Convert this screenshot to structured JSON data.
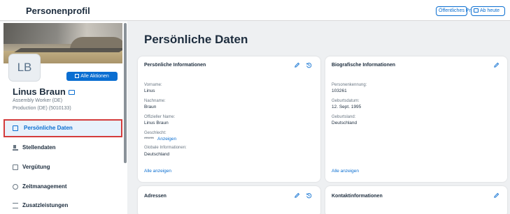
{
  "header": {
    "title": "Personenprofil",
    "public_profile_label": "Öffentliches Profil",
    "as_of_label": "Ab heute"
  },
  "profile": {
    "avatar_initials": "LB",
    "actions_label": "Alle Aktionen",
    "name": "Linus Braun",
    "job_title": "Assembly Worker (DE)",
    "org": "Production (DE) (5010133)"
  },
  "nav": {
    "items": [
      {
        "label": "Persönliche Daten",
        "icon": "person-card-icon",
        "active": true
      },
      {
        "label": "Stellendaten",
        "icon": "job-icon",
        "active": false
      },
      {
        "label": "Vergütung",
        "icon": "money-icon",
        "active": false
      },
      {
        "label": "Zeitmanagement",
        "icon": "clock-icon",
        "active": false
      },
      {
        "label": "Zusatzleistungen",
        "icon": "benefits-icon",
        "active": false
      }
    ]
  },
  "main": {
    "page_title": "Persönliche Daten",
    "personal_info": {
      "title": "Persönliche Informationen",
      "first_name_label": "Vorname:",
      "first_name": "Linus",
      "last_name_label": "Nachname:",
      "last_name": "Braun",
      "official_name_label": "Offizieller Name:",
      "official_name": "Linus Braun",
      "gender_label": "Geschlecht:",
      "gender_masked": "******",
      "show_label": "Anzeigen",
      "global_info_label": "Globale Informationen:",
      "global_info": "Deutschland",
      "show_all": "Alle anzeigen"
    },
    "bio_info": {
      "title": "Biografische Informationen",
      "person_id_label": "Personenkennung:",
      "person_id": "103261",
      "birth_date_label": "Geburtsdatum:",
      "birth_date": "12. Sept. 1995",
      "birth_country_label": "Geburtsland:",
      "birth_country": "Deutschland",
      "show_all": "Alle anzeigen"
    },
    "addresses": {
      "title": "Adressen"
    },
    "contact": {
      "title": "Kontaktinformationen"
    }
  },
  "colors": {
    "accent": "#0a6ed1",
    "highlight_border": "#d43c3c"
  }
}
